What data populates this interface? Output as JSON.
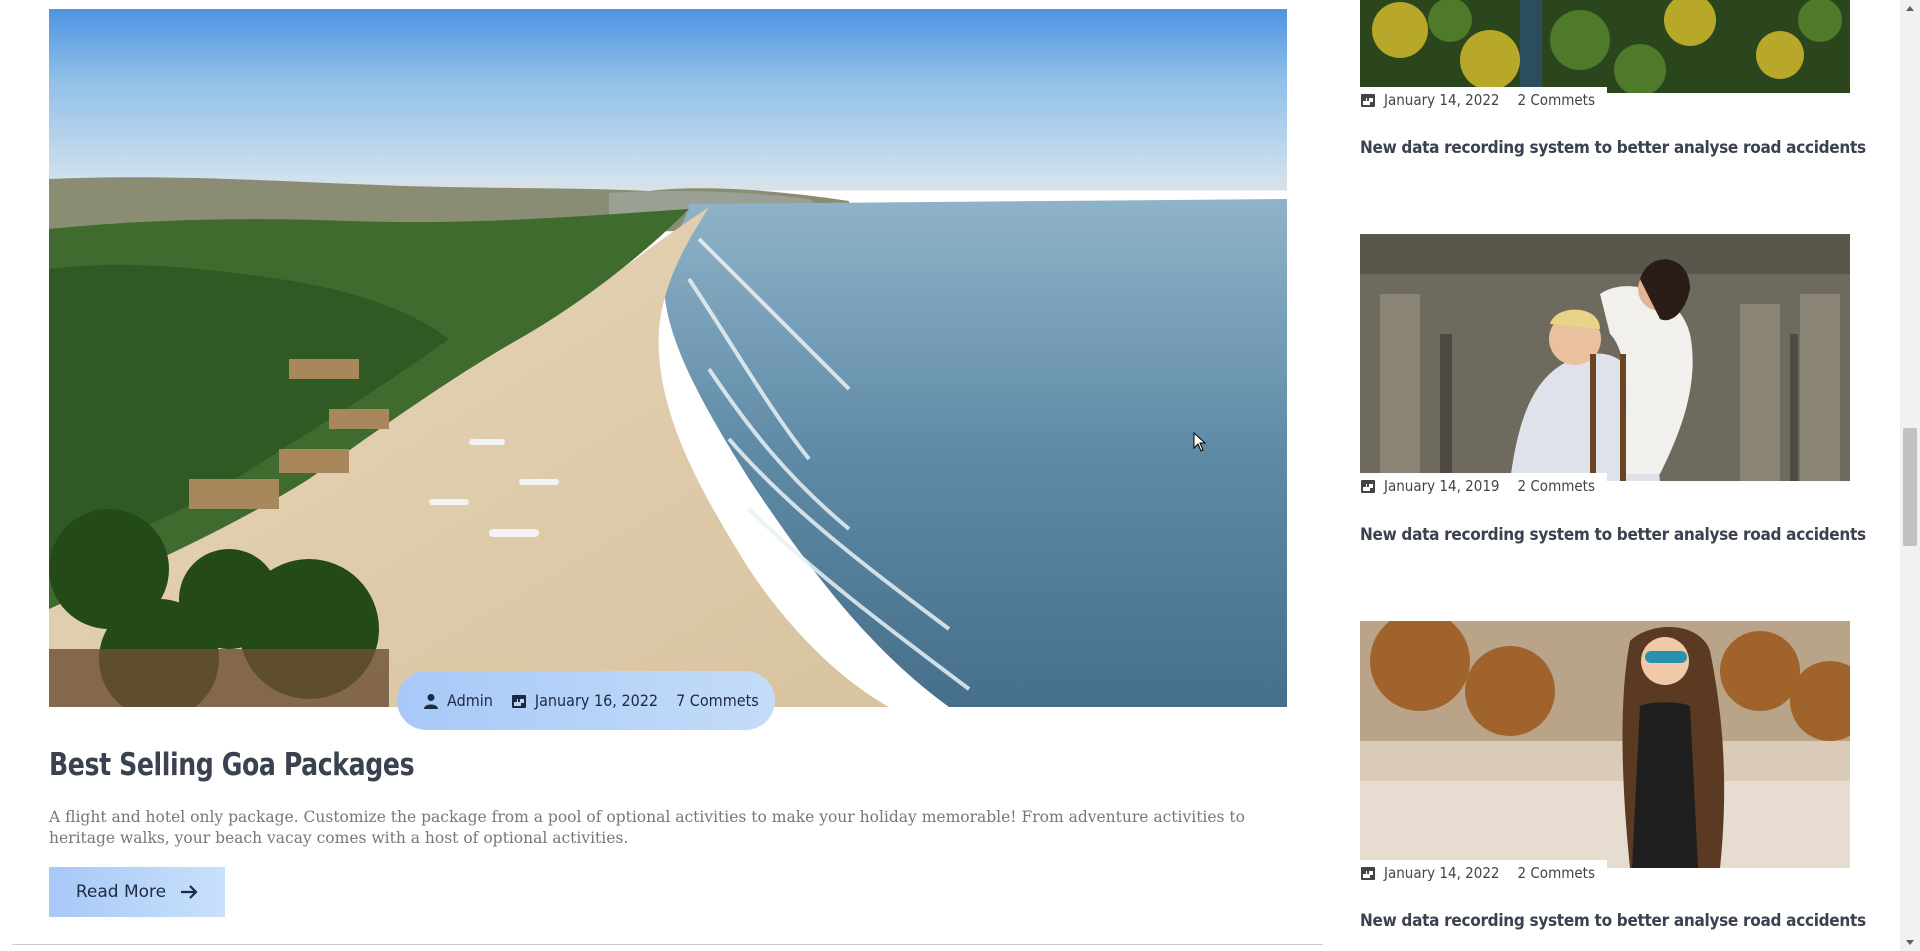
{
  "main_post": {
    "image_alt": "Goa beach aerial view",
    "author": "Admin",
    "date": "January 16, 2022",
    "comments": "7 Commets",
    "title": "Best Selling Goa Packages",
    "excerpt": "A flight and hotel only package. Customize the package from a pool of optional activities to make your holiday memorable! From adventure activities to heritage walks, your beach vacay comes with a host of optional activities.",
    "read_more_label": "Read More"
  },
  "sidebar": {
    "posts": [
      {
        "image_alt": "Aerial forest",
        "date": "January 14, 2022",
        "comments": "2 Commets",
        "title": "New data recording system to better analyse road accidents"
      },
      {
        "image_alt": "Wedding couple",
        "date": "January 14, 2019",
        "comments": "2 Commets",
        "title": "New data recording system to better analyse road accidents"
      },
      {
        "image_alt": "Woman with sunglasses",
        "date": "January 14, 2022",
        "comments": "2 Commets",
        "title": "New data recording system to better analyse road accidents"
      }
    ]
  },
  "icons": {
    "user": "user-icon",
    "calendar": "calendar-icon",
    "arrow": "arrow-right-icon"
  },
  "colors": {
    "accent_gradient_start": "#a8c8f8",
    "accent_gradient_end": "#c8e0fa",
    "title": "#3a4150",
    "text": "#777777"
  }
}
